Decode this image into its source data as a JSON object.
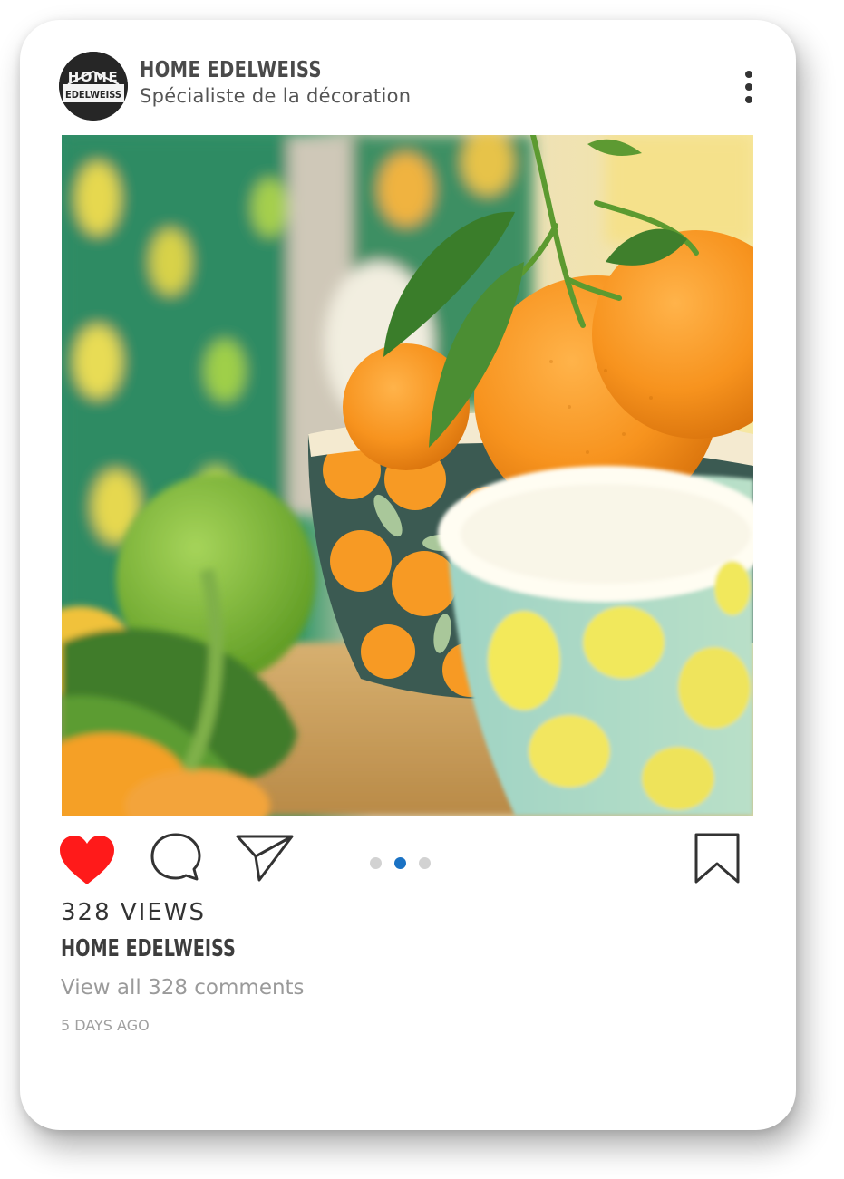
{
  "post": {
    "account_name": "HOME EDELWEISS",
    "account_subtitle": "Spécialiste de la décoration",
    "avatar": {
      "line1": "HOME",
      "line2": "EDELWEISS"
    },
    "image_description": "oranges-and-lemon-bowls",
    "views": "328 VIEWS",
    "caption_name": "HOME EDELWEISS",
    "view_comments": "View all 328 comments",
    "timestamp": "5 DAYS AGO",
    "carousel": {
      "count": 3,
      "active_index": 1
    },
    "liked": true
  },
  "icons": {
    "more": "more-vertical-icon",
    "like": "heart-icon",
    "comment": "comment-icon",
    "share": "send-icon",
    "bookmark": "bookmark-icon"
  },
  "colors": {
    "like_red": "#ff1a1a",
    "carousel_active": "#1a72c4",
    "carousel_inactive": "#d2d2d2",
    "text_dark": "#333333",
    "text_muted": "#9a9a9a"
  }
}
